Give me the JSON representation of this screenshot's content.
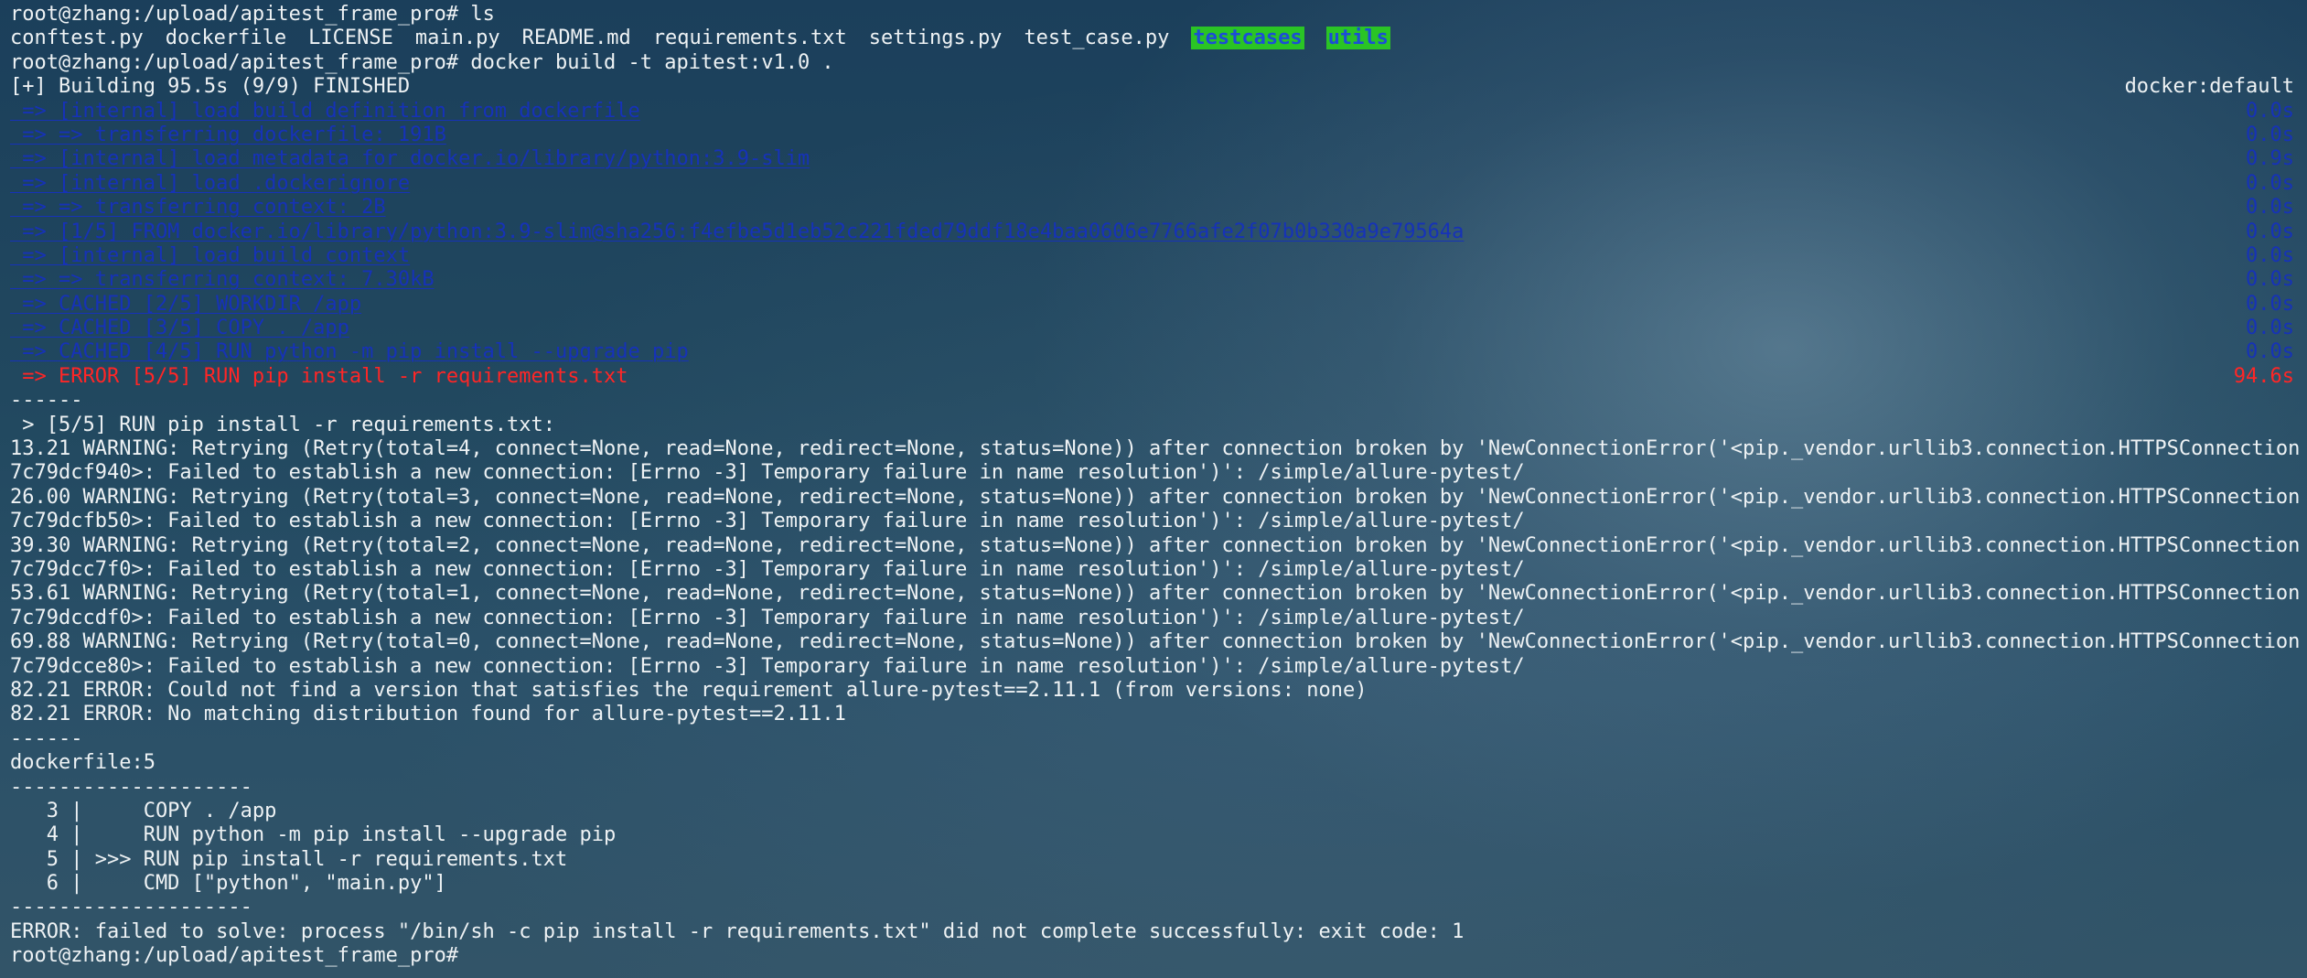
{
  "terminal": {
    "prompt": "root@zhang:/upload/apitest_frame_pro#",
    "cmd_ls": "ls",
    "ls_files": [
      "conftest.py",
      "dockerfile",
      "LICENSE",
      "main.py",
      "README.md",
      "requirements.txt",
      "settings.py",
      "test_case.py"
    ],
    "ls_dirs": [
      "testcases",
      "utils"
    ],
    "cmd_build": "docker build -t apitest:v1.0 .",
    "build_header": "[+] Building 95.5s (9/9) FINISHED",
    "builder": "docker:default",
    "steps": [
      {
        "text": " => [internal] load build definition from dockerfile",
        "time": "0.0s"
      },
      {
        "text": " => => transferring dockerfile: 191B",
        "time": "0.0s"
      },
      {
        "text": " => [internal] load metadata for docker.io/library/python:3.9-slim",
        "time": "0.9s"
      },
      {
        "text": " => [internal] load .dockerignore",
        "time": "0.0s"
      },
      {
        "text": " => => transferring context: 2B",
        "time": "0.0s"
      },
      {
        "text": " => [1/5] FROM docker.io/library/python:3.9-slim@sha256:f4efbe5d1eb52c221fded79ddf18e4baa0606e7766afe2f07b0b330a9e79564a",
        "time": "0.0s"
      },
      {
        "text": " => [internal] load build context",
        "time": "0.0s"
      },
      {
        "text": " => => transferring context: 7.30kB",
        "time": "0.0s"
      },
      {
        "text": " => CACHED [2/5] WORKDIR /app",
        "time": "0.0s"
      },
      {
        "text": " => CACHED [3/5] COPY . /app",
        "time": "0.0s"
      },
      {
        "text": " => CACHED [4/5] RUN python -m pip install --upgrade pip",
        "time": "0.0s"
      }
    ],
    "error_step": {
      "text": " => ERROR [5/5] RUN pip install -r requirements.txt",
      "time": "94.6s"
    },
    "separator_short": "------",
    "run_header": " > [5/5] RUN pip install -r requirements.txt:",
    "output_lines": [
      "13.21 WARNING: Retrying (Retry(total=4, connect=None, read=None, redirect=None, status=None)) after connection broken by 'NewConnectionError('<pip._vendor.urllib3.connection.HTTPSConnection object at 0x77",
      "7c79dcf940>: Failed to establish a new connection: [Errno -3] Temporary failure in name resolution')': /simple/allure-pytest/",
      "26.00 WARNING: Retrying (Retry(total=3, connect=None, read=None, redirect=None, status=None)) after connection broken by 'NewConnectionError('<pip._vendor.urllib3.connection.HTTPSConnection object at 0x77",
      "7c79dcfb50>: Failed to establish a new connection: [Errno -3] Temporary failure in name resolution')': /simple/allure-pytest/",
      "39.30 WARNING: Retrying (Retry(total=2, connect=None, read=None, redirect=None, status=None)) after connection broken by 'NewConnectionError('<pip._vendor.urllib3.connection.HTTPSConnection object at 0x77",
      "7c79dcc7f0>: Failed to establish a new connection: [Errno -3] Temporary failure in name resolution')': /simple/allure-pytest/",
      "53.61 WARNING: Retrying (Retry(total=1, connect=None, read=None, redirect=None, status=None)) after connection broken by 'NewConnectionError('<pip._vendor.urllib3.connection.HTTPSConnection object at 0x77",
      "7c79dccdf0>: Failed to establish a new connection: [Errno -3] Temporary failure in name resolution')': /simple/allure-pytest/",
      "69.88 WARNING: Retrying (Retry(total=0, connect=None, read=None, redirect=None, status=None)) after connection broken by 'NewConnectionError('<pip._vendor.urllib3.connection.HTTPSConnection object at 0x77",
      "7c79dcce80>: Failed to establish a new connection: [Errno -3] Temporary failure in name resolution')': /simple/allure-pytest/",
      "82.21 ERROR: Could not find a version that satisfies the requirement allure-pytest==2.11.1 (from versions: none)",
      "82.21 ERROR: No matching distribution found for allure-pytest==2.11.1"
    ],
    "dockerfile_ref": "dockerfile:5",
    "separator_long": "--------------------",
    "dockerfile_lines": [
      "   3 |     COPY . /app",
      "   4 |     RUN python -m pip install --upgrade pip",
      "   5 | >>> RUN pip install -r requirements.txt",
      "   6 |     CMD [\"python\", \"main.py\"]"
    ],
    "final_error": "ERROR: failed to solve: process \"/bin/sh -c pip install -r requirements.txt\" did not complete successfully: exit code: 1",
    "colors": {
      "step": "#1632b8",
      "error": "#ff2626",
      "dir_bg": "#2ac425",
      "dir_fg": "#1c4dd6"
    }
  }
}
